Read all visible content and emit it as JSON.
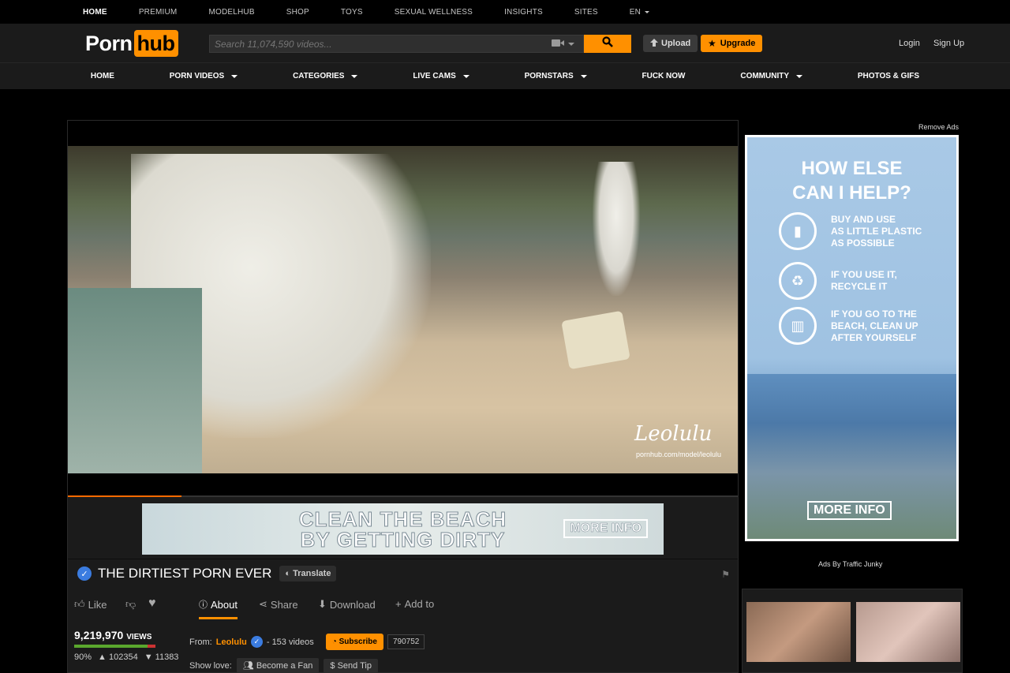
{
  "topbar": {
    "items": [
      "HOME",
      "PREMIUM",
      "MODELHUB",
      "SHOP",
      "TOYS",
      "SEXUAL WELLNESS",
      "INSIGHTS",
      "SITES",
      "EN"
    ]
  },
  "header": {
    "logo_part1": "Porn",
    "logo_part2": "hub",
    "search_placeholder": "Search 11,074,590 videos...",
    "upload_label": "Upload",
    "upgrade_label": "Upgrade",
    "login_label": "Login",
    "signup_label": "Sign Up"
  },
  "nav": {
    "items": [
      {
        "label": "HOME",
        "caret": false
      },
      {
        "label": "PORN VIDEOS",
        "caret": true
      },
      {
        "label": "CATEGORIES",
        "caret": true
      },
      {
        "label": "LIVE CAMS",
        "caret": true
      },
      {
        "label": "PORNSTARS",
        "caret": true
      },
      {
        "label": "FUCK NOW",
        "caret": false
      },
      {
        "label": "COMMUNITY",
        "caret": true
      },
      {
        "label": "PHOTOS & GIFS",
        "caret": false
      }
    ]
  },
  "video": {
    "watermark_name": "Leolulu",
    "watermark_url": "pornhub.com/model/leolulu",
    "progress_fraction": 0.17
  },
  "banner": {
    "line1": "CLEAN THE BEACH",
    "line2": "BY GETTING DIRTY",
    "more": "MORE INFO"
  },
  "title": {
    "text": "THE DIRTIEST PORN EVER",
    "translate": "Translate"
  },
  "actions": {
    "like": "Like",
    "about": "About",
    "share": "Share",
    "download": "Download",
    "add_to": "Add to"
  },
  "stats": {
    "views": "9,219,970",
    "views_label": "VIEWS",
    "percent": "90%",
    "likes": "102354",
    "dislikes": "11383",
    "rating_fraction": 0.9
  },
  "uploader": {
    "from_label": "From:",
    "name": "Leolulu",
    "videos": "- 153 videos",
    "subscribe": "Subscribe",
    "subscribers": "790752",
    "show_love": "Show love:",
    "become_fan": "Become a Fan",
    "send_tip": "Send Tip"
  },
  "sidebar": {
    "remove_ads": "Remove Ads",
    "ad_heading1": "HOW ELSE",
    "ad_heading2": "CAN I HELP?",
    "ad_tips": [
      [
        "BUY AND USE",
        "AS LITTLE PLASTIC",
        "AS POSSIBLE"
      ],
      [
        "IF YOU USE IT,",
        "RECYCLE IT"
      ],
      [
        "IF YOU GO TO THE",
        "BEACH, CLEAN UP",
        "AFTER YOURSELF"
      ]
    ],
    "ad_more": "MORE INFO",
    "ads_by": "Ads By Traffic Junky"
  },
  "colors": {
    "brand": "#ff9000",
    "header_bg": "#1b1b1b",
    "verified": "#3b7ce0"
  }
}
